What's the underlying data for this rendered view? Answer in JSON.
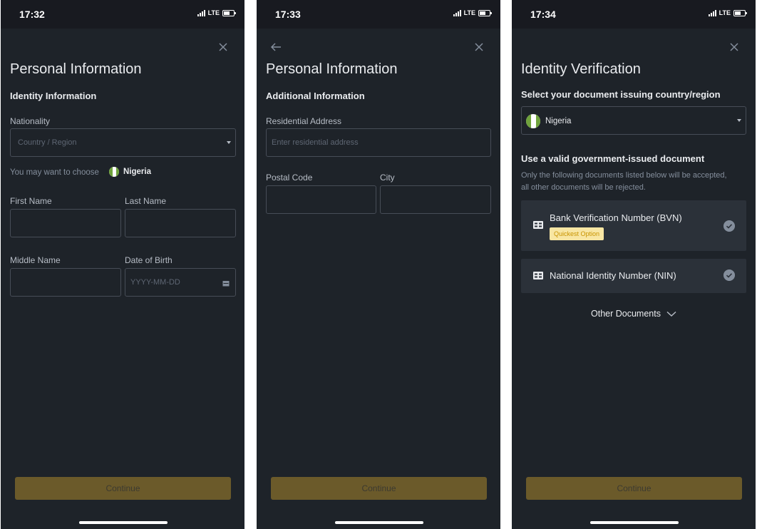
{
  "screen1": {
    "time": "17:32",
    "network": "LTE",
    "title": "Personal Information",
    "section": "Identity Information",
    "nationality_label": "Nationality",
    "nationality_placeholder": "Country / Region",
    "suggestion_text": "You may want to choose",
    "suggestion_country": "Nigeria",
    "first_name_label": "First Name",
    "last_name_label": "Last Name",
    "middle_name_label": "Middle Name",
    "dob_label": "Date of Birth",
    "dob_placeholder": "YYYY-MM-DD",
    "continue_label": "Continue"
  },
  "screen2": {
    "time": "17:33",
    "network": "LTE",
    "title": "Personal Information",
    "section": "Additional Information",
    "address_label": "Residential Address",
    "address_placeholder": "Enter residential address",
    "postal_label": "Postal Code",
    "city_label": "City",
    "continue_label": "Continue"
  },
  "screen3": {
    "time": "17:34",
    "network": "LTE",
    "title": "Identity Verification",
    "country_prompt": "Select your document issuing country/region",
    "selected_country": "Nigeria",
    "doc_heading": "Use a valid government-issued document",
    "doc_note_line1": "Only the following documents listed below will be accepted,",
    "doc_note_line2": "all other documents will be rejected.",
    "documents": [
      {
        "label": "Bank Verification Number (BVN)",
        "badge": "Quickest Option"
      },
      {
        "label": "National Identity Number (NIN)"
      }
    ],
    "other_documents": "Other Documents",
    "continue_label": "Continue"
  },
  "colors": {
    "background": "#1e2329",
    "status_bar": "#181a20",
    "field_border": "#474d57",
    "card": "#2b3139",
    "button_disabled": "#6b5a2a",
    "badge_bg": "#f8e6a3",
    "badge_text": "#c99400",
    "flag_green": "#6fa23c"
  }
}
